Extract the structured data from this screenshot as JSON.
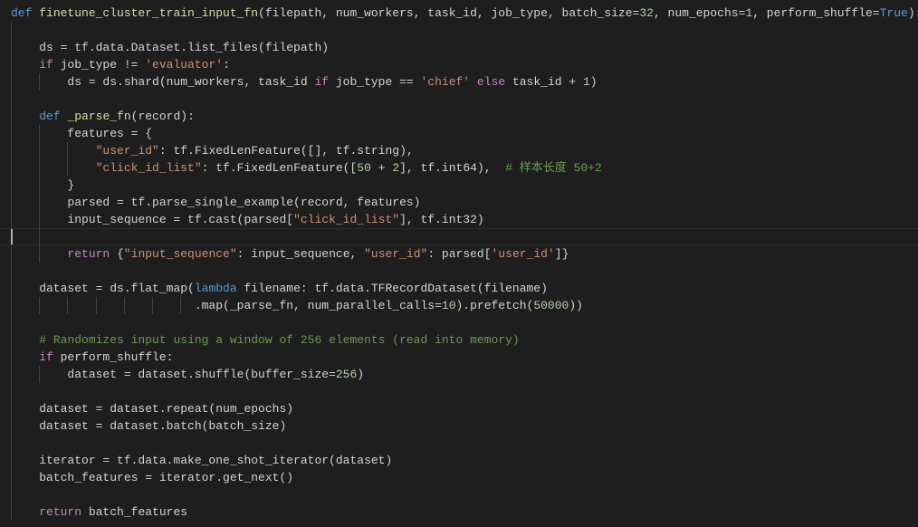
{
  "editor": {
    "cursor_line": 13,
    "colors": {
      "background": "#1e1e1e",
      "keyword": "#569cd6",
      "control": "#c586c0",
      "function": "#dcdcaa",
      "string": "#ce9178",
      "number": "#b5cea8",
      "comment": "#6a9955",
      "text": "#d4d4d4"
    },
    "lines": [
      [
        [
          "k",
          "def"
        ],
        [
          "t",
          " "
        ],
        [
          "f",
          "finetune_cluster_train_input_fn"
        ],
        [
          "t",
          "(filepath, num_workers, task_id, job_type, batch_size="
        ],
        [
          "n",
          "32"
        ],
        [
          "t",
          ", num_epochs="
        ],
        [
          "n",
          "1"
        ],
        [
          "t",
          ", perform_shuffle="
        ],
        [
          "k",
          "True"
        ],
        [
          "t",
          "):"
        ]
      ],
      [
        [
          "t",
          "    "
        ]
      ],
      [
        [
          "t",
          "    ds = tf.data.Dataset.list_files(filepath)"
        ]
      ],
      [
        [
          "t",
          "    "
        ],
        [
          "c",
          "if"
        ],
        [
          "t",
          " job_type != "
        ],
        [
          "s",
          "'evaluator'"
        ],
        [
          "t",
          ":"
        ]
      ],
      [
        [
          "t",
          "        ds = ds.shard(num_workers, task_id "
        ],
        [
          "c",
          "if"
        ],
        [
          "t",
          " job_type == "
        ],
        [
          "s",
          "'chief'"
        ],
        [
          "t",
          " "
        ],
        [
          "c",
          "else"
        ],
        [
          "t",
          " task_id + "
        ],
        [
          "n",
          "1"
        ],
        [
          "t",
          ")"
        ]
      ],
      [
        [
          "t",
          "    "
        ]
      ],
      [
        [
          "t",
          "    "
        ],
        [
          "k",
          "def"
        ],
        [
          "t",
          " "
        ],
        [
          "f",
          "_parse_fn"
        ],
        [
          "t",
          "(record):"
        ]
      ],
      [
        [
          "t",
          "        features = {"
        ]
      ],
      [
        [
          "t",
          "            "
        ],
        [
          "s",
          "\"user_id\""
        ],
        [
          "t",
          ": tf.FixedLenFeature([], tf.string),"
        ]
      ],
      [
        [
          "t",
          "            "
        ],
        [
          "s",
          "\"click_id_list\""
        ],
        [
          "t",
          ": tf.FixedLenFeature(["
        ],
        [
          "n",
          "50"
        ],
        [
          "t",
          " + "
        ],
        [
          "n",
          "2"
        ],
        [
          "t",
          "], tf.int64),  "
        ],
        [
          "m",
          "# 样本长度 50+2"
        ]
      ],
      [
        [
          "t",
          "        }"
        ]
      ],
      [
        [
          "t",
          "        parsed = tf.parse_single_example(record, features)"
        ]
      ],
      [
        [
          "t",
          "        input_sequence = tf.cast(parsed["
        ],
        [
          "s",
          "\"click_id_list\""
        ],
        [
          "t",
          "], tf.int32)"
        ]
      ],
      [
        [
          "t",
          "        "
        ]
      ],
      [
        [
          "t",
          "        "
        ],
        [
          "c",
          "return"
        ],
        [
          "t",
          " {"
        ],
        [
          "s",
          "\"input_sequence\""
        ],
        [
          "t",
          ": input_sequence, "
        ],
        [
          "s",
          "\"user_id\""
        ],
        [
          "t",
          ": parsed["
        ],
        [
          "s",
          "'user_id'"
        ],
        [
          "t",
          "]}"
        ]
      ],
      [
        [
          "t",
          "    "
        ]
      ],
      [
        [
          "t",
          "    dataset = ds.flat_map("
        ],
        [
          "k",
          "lambda"
        ],
        [
          "t",
          " filename: tf.data.TFRecordDataset(filename)"
        ]
      ],
      [
        [
          "t",
          "                          .map(_parse_fn, num_parallel_calls="
        ],
        [
          "n",
          "10"
        ],
        [
          "t",
          ").prefetch("
        ],
        [
          "n",
          "50000"
        ],
        [
          "t",
          "))"
        ]
      ],
      [
        [
          "t",
          "    "
        ]
      ],
      [
        [
          "t",
          "    "
        ],
        [
          "m",
          "# Randomizes input using a window of 256 elements (read into memory)"
        ]
      ],
      [
        [
          "t",
          "    "
        ],
        [
          "c",
          "if"
        ],
        [
          "t",
          " perform_shuffle:"
        ]
      ],
      [
        [
          "t",
          "        dataset = dataset.shuffle(buffer_size="
        ],
        [
          "n",
          "256"
        ],
        [
          "t",
          ")"
        ]
      ],
      [
        [
          "t",
          "    "
        ]
      ],
      [
        [
          "t",
          "    dataset = dataset.repeat(num_epochs)"
        ]
      ],
      [
        [
          "t",
          "    dataset = dataset.batch(batch_size)"
        ]
      ],
      [
        [
          "t",
          "    "
        ]
      ],
      [
        [
          "t",
          "    iterator = tf.data.make_one_shot_iterator(dataset)"
        ]
      ],
      [
        [
          "t",
          "    batch_features = iterator.get_next()"
        ]
      ],
      [
        [
          "t",
          "    "
        ]
      ],
      [
        [
          "t",
          "    "
        ],
        [
          "c",
          "return"
        ],
        [
          "t",
          " batch_features"
        ]
      ]
    ]
  }
}
